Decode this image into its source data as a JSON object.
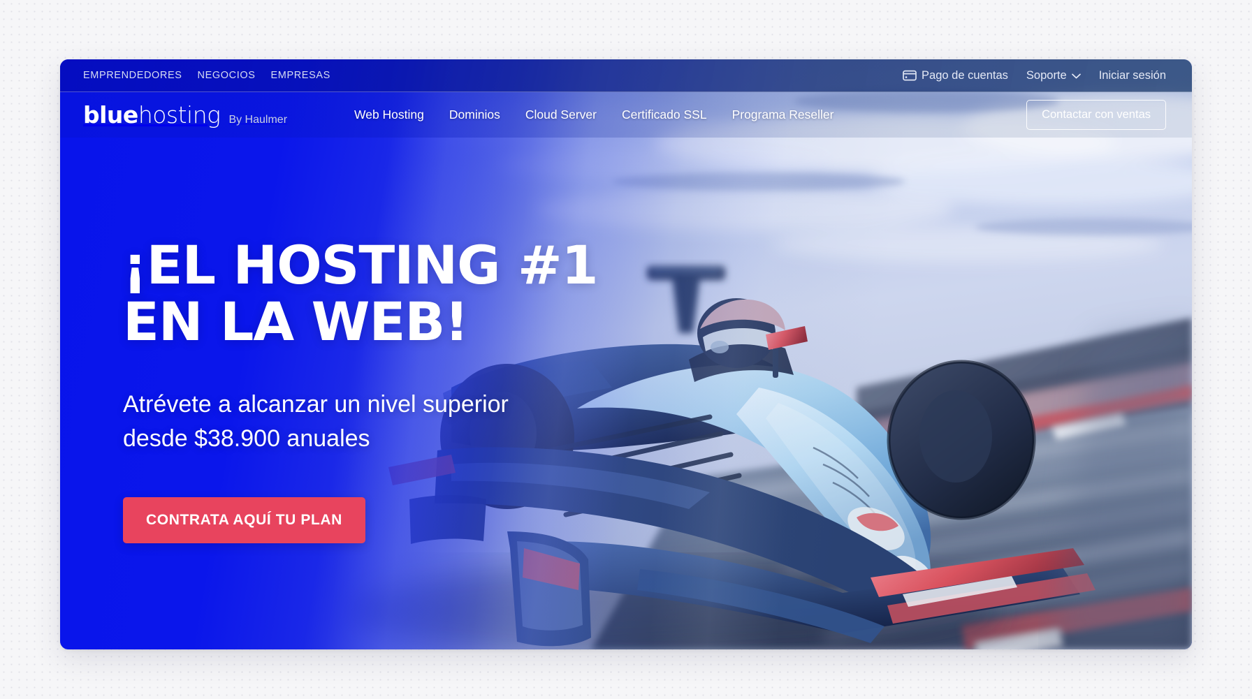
{
  "topbar": {
    "segments": [
      {
        "label": "EMPRENDEDORES"
      },
      {
        "label": "NEGOCIOS"
      },
      {
        "label": "EMPRESAS"
      }
    ],
    "payment": {
      "label": "Pago de cuentas",
      "icon": "credit-card-icon"
    },
    "support": {
      "label": "Soporte",
      "icon": "chevron-down-icon"
    },
    "login": {
      "label": "Iniciar sesión"
    }
  },
  "nav": {
    "logo": {
      "strong": "blue",
      "thin": "hosting",
      "byline": "By Haulmer"
    },
    "links": [
      {
        "label": "Web Hosting"
      },
      {
        "label": "Dominios"
      },
      {
        "label": "Cloud Server"
      },
      {
        "label": "Certificado SSL"
      },
      {
        "label": "Programa Reseller"
      }
    ],
    "sales_button": "Contactar con ventas"
  },
  "hero": {
    "title": "¡EL HOSTING #1\nEN LA WEB!",
    "subtitle": "Atrévete a alcanzar un nivel superior\ndesde $38.900 anuales",
    "cta": "CONTRATA AQUÍ TU PLAN",
    "image_alt": "formula-1-race-car-on-track"
  },
  "colors": {
    "brand_blue": "#0814eb",
    "cta_red": "#e8445e",
    "page_background": "#f6f6f8",
    "topbar_overlay": "#0c1e8c"
  }
}
